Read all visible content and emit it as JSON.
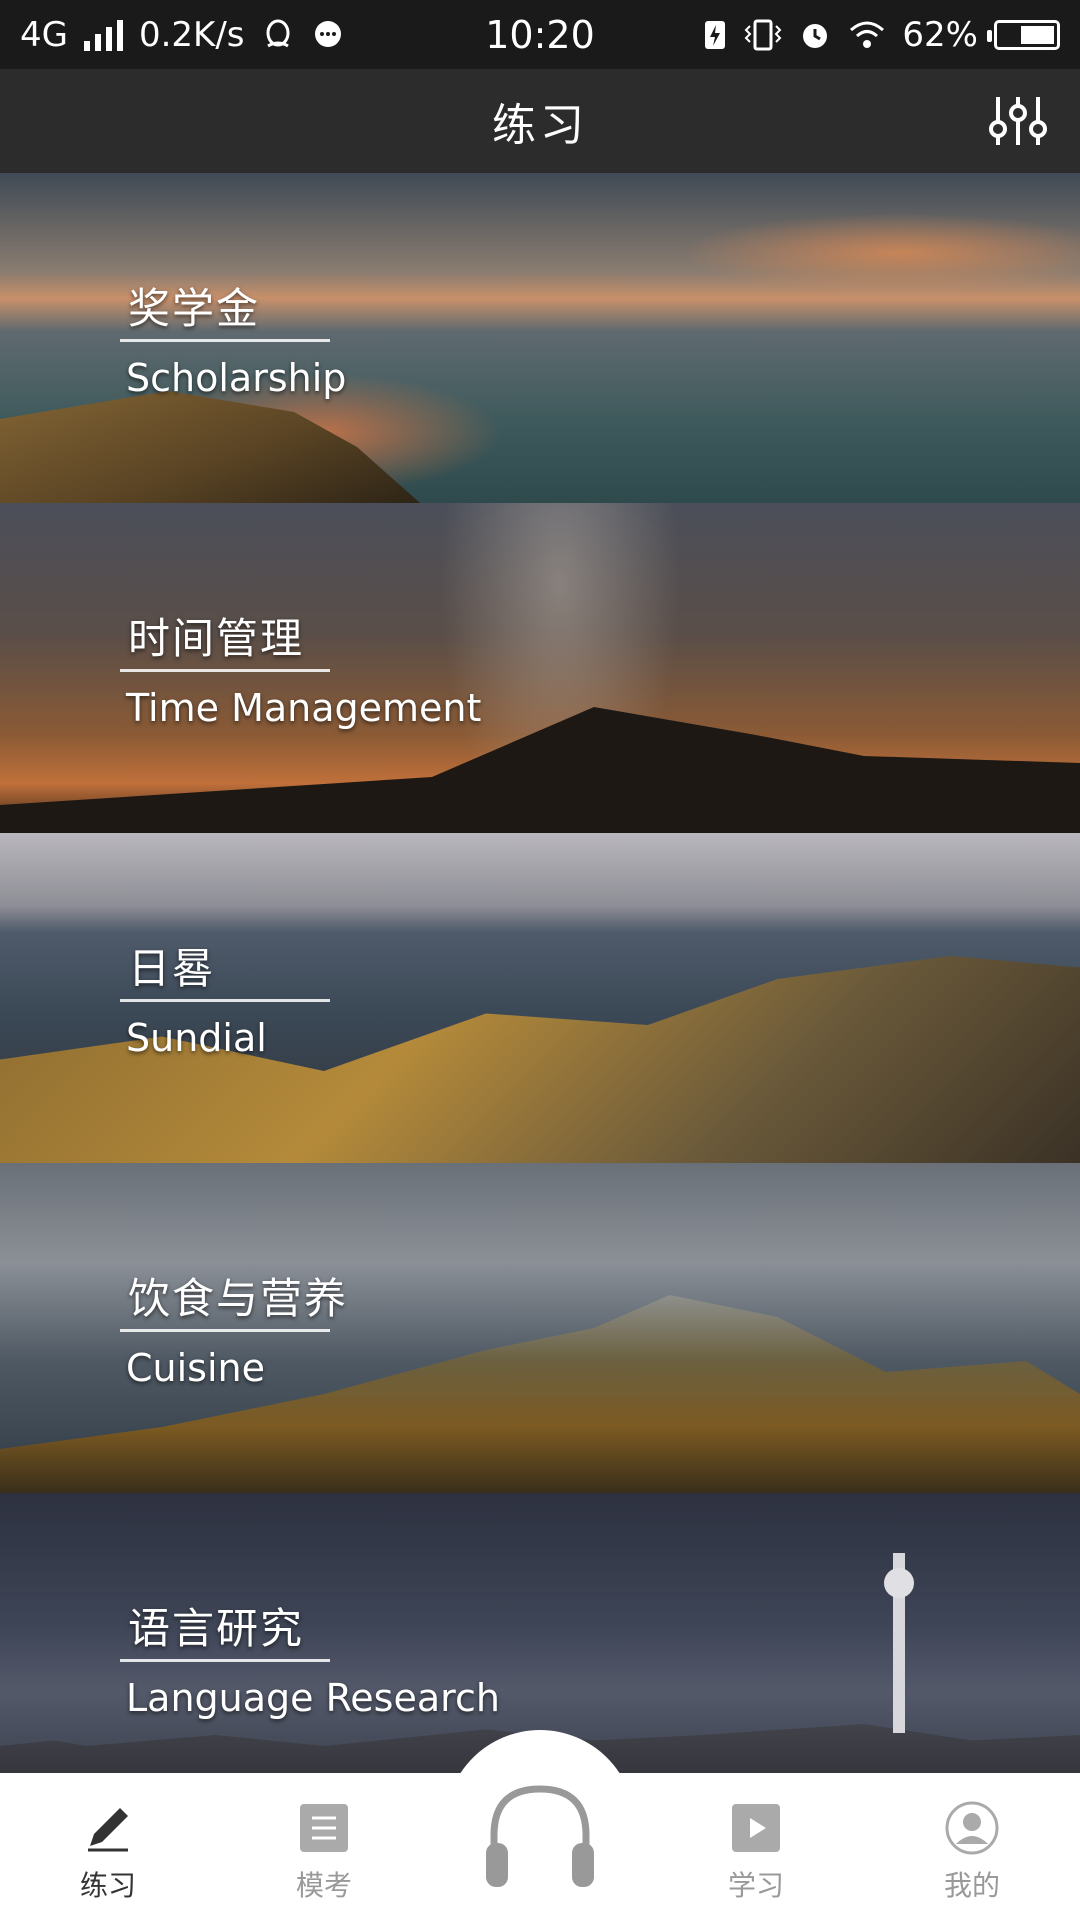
{
  "status_bar": {
    "network": "4G",
    "speed": "0.2K/s",
    "time": "10:20",
    "battery_percent": "62%",
    "battery_level": 0.62
  },
  "header": {
    "title": "练习"
  },
  "cards": [
    {
      "title_cn": "奖学金",
      "title_en": "Scholarship"
    },
    {
      "title_cn": "时间管理",
      "title_en": "Time Management"
    },
    {
      "title_cn": "日晷",
      "title_en": "Sundial"
    },
    {
      "title_cn": "饮食与营养",
      "title_en": "Cuisine"
    },
    {
      "title_cn": "语言研究",
      "title_en": "Language Research"
    }
  ],
  "tabs": [
    {
      "label": "练习",
      "icon": "pencil-icon",
      "active": true
    },
    {
      "label": "模考",
      "icon": "document-icon",
      "active": false
    },
    {
      "label": "",
      "icon": "headphones-icon",
      "active": false
    },
    {
      "label": "学习",
      "icon": "play-icon",
      "active": false
    },
    {
      "label": "我的",
      "icon": "profile-icon",
      "active": false
    }
  ]
}
